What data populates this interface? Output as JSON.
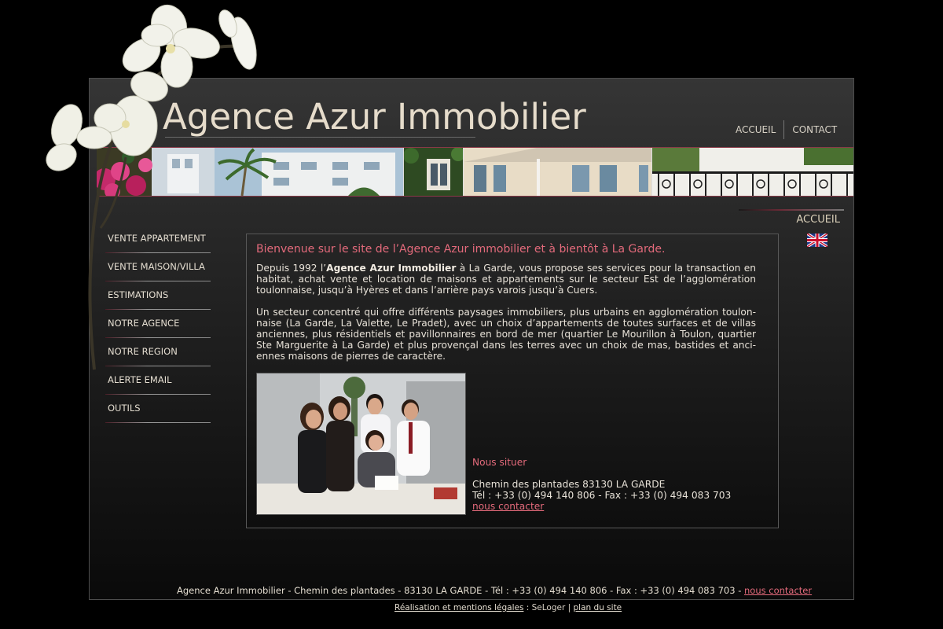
{
  "site": {
    "logo_text": "Agence Azur Immobilier"
  },
  "topnav": [
    {
      "label": "ACCUEIL"
    },
    {
      "label": "CONTACT"
    }
  ],
  "breadcrumb": "ACCUEIL",
  "leftnav": [
    {
      "label": "VENTE APPARTEMENT"
    },
    {
      "label": "VENTE MAISON/VILLA"
    },
    {
      "label": "ESTIMATIONS"
    },
    {
      "label": "NOTRE AGENCE"
    },
    {
      "label": "NOTRE REGION"
    },
    {
      "label": "ALERTE EMAIL"
    },
    {
      "label": "OUTILS"
    }
  ],
  "content": {
    "title": "Bienvenue sur le site de l’Agence Azur immobilier et à bientôt à La Garde.",
    "p1_before": "Depuis 1992 l’",
    "p1_bold": "Agence Azur Immobilier",
    "p1_after": " à La Garde, vous propose ses services pour la transaction en habitat, achat vente et location de maisons et appartements sur le secteur Est de l’agglomération toulonnaise, jusqu’à Hyères et dans l’arrière pays varois jusqu’à Cuers.",
    "p2": "Un secteur concentré qui offre différents paysages immobiliers, plus urbains en agglomération toulon-naise (La Garde, La Valette, Le Pradet), avec un choix d’appartements de toutes surfaces et de villas anciennes, plus résidentiels et pavillonnaires en bord de mer (quartier Le Mourillon à Toulon, quartier Ste Marguerite à La Garde) et plus provençal dans les terres avec un choix de mas, bastides et anci-ennes maisons de pierres de caractère."
  },
  "contact": {
    "title": "Nous situer",
    "address": "Chemin des plantades 83130 LA GARDE",
    "phone": "Tél : +33 (0) 494 140 806 - Fax : +33 (0) 494 083 703",
    "link": "nous contacter"
  },
  "footer": {
    "text": "Agence Azur Immobilier - Chemin des plantades - 83130 LA GARDE - Tél : +33 (0) 494 140 806 - Fax : +33 (0) 494 083 703 - ",
    "link": "nous contacter"
  },
  "subfooter": {
    "link1": "Réalisation et mentions légales",
    "middle": " : SeLoger | ",
    "link2": "plan du site"
  },
  "icons": {
    "flag": "uk-flag-icon"
  }
}
